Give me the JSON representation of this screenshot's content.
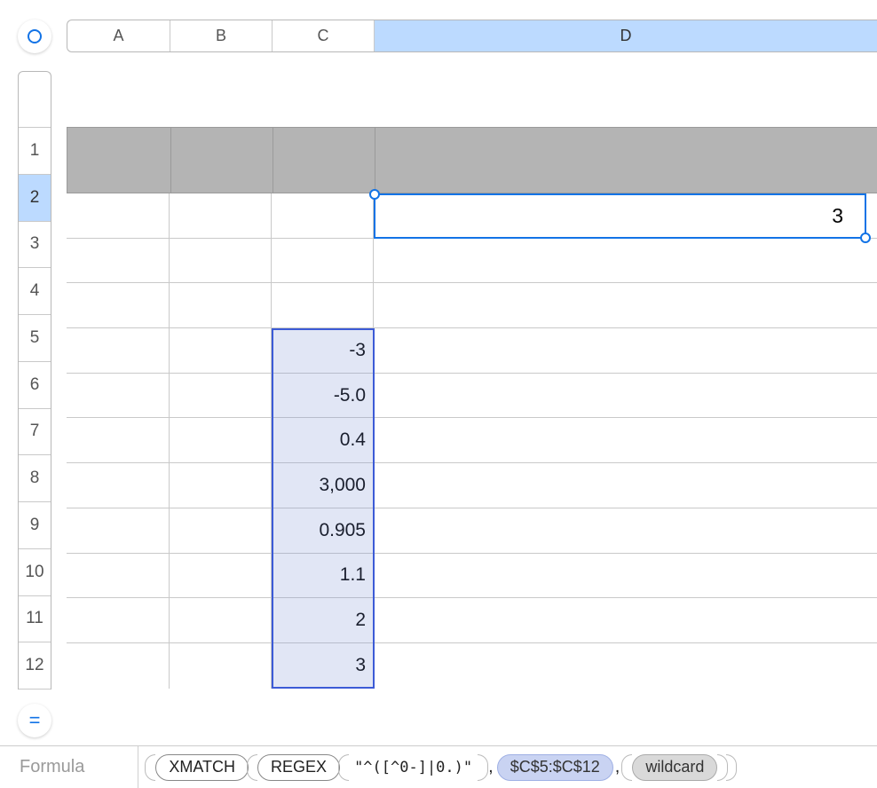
{
  "columns": {
    "A": "A",
    "B": "B",
    "C": "C",
    "D": "D"
  },
  "rows": [
    "1",
    "2",
    "3",
    "4",
    "5",
    "6",
    "7",
    "8",
    "9",
    "10",
    "11",
    "12"
  ],
  "selected_column": "D",
  "selected_row": "2",
  "selection_value": "3",
  "range_ref": "$C$5:$C$12",
  "col_c_values": {
    "5": "-3",
    "6": "-5.0",
    "7": "0.4",
    "8": "3,000",
    "9": "0.905",
    "10": "1.1",
    "11": "2",
    "12": "3"
  },
  "formula_bar": {
    "label": "Formula",
    "fn_outer": "XMATCH",
    "fn_inner": "REGEX",
    "regex_literal": "\"^([^0-]|0.)\"",
    "range": "$C$5:$C$12",
    "mode": "wildcard"
  },
  "equals_glyph": "="
}
